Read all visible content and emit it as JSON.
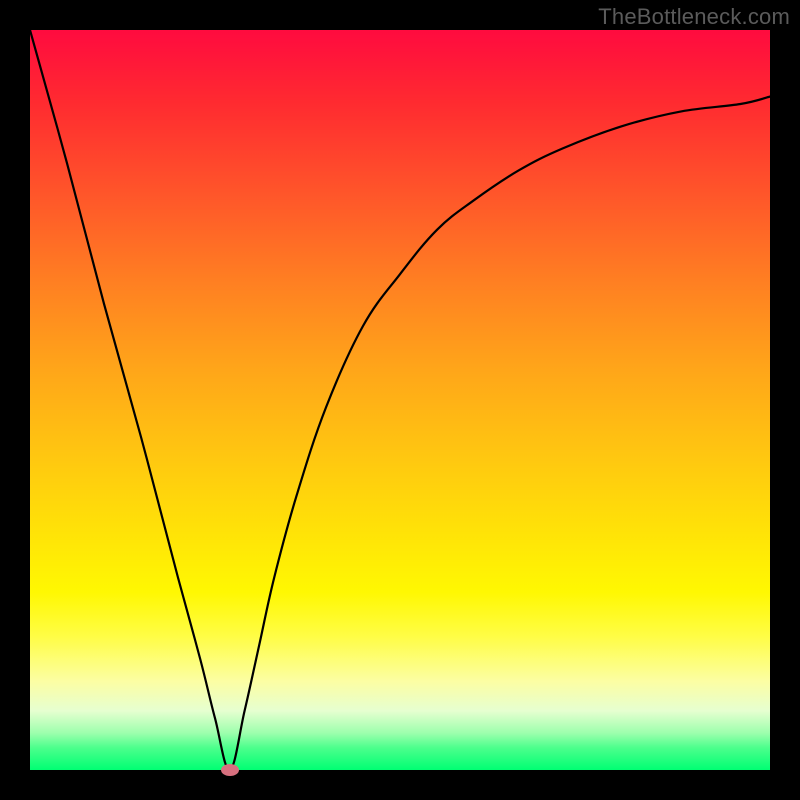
{
  "watermark": "TheBottleneck.com",
  "colors": {
    "frame": "#000000",
    "marker": "#d7707f",
    "curve": "#000000",
    "gradient_top": "#ff0b3f",
    "gradient_bottom": "#00ff73"
  },
  "chart_data": {
    "type": "line",
    "title": "",
    "xlabel": "",
    "ylabel": "",
    "xlim": [
      0,
      100
    ],
    "ylim": [
      0,
      100
    ],
    "grid": false,
    "legend": false,
    "marker": {
      "x": 27,
      "y": 0
    },
    "series": [
      {
        "name": "curve",
        "x": [
          0,
          5,
          10,
          15,
          20,
          23,
          25,
          27,
          29,
          31,
          33,
          36,
          40,
          45,
          50,
          55,
          60,
          66,
          72,
          80,
          88,
          96,
          100
        ],
        "values": [
          100,
          82,
          63,
          45,
          26,
          15,
          7,
          0,
          8,
          17,
          26,
          37,
          49,
          60,
          67,
          73,
          77,
          81,
          84,
          87,
          89,
          90,
          91
        ]
      }
    ]
  }
}
